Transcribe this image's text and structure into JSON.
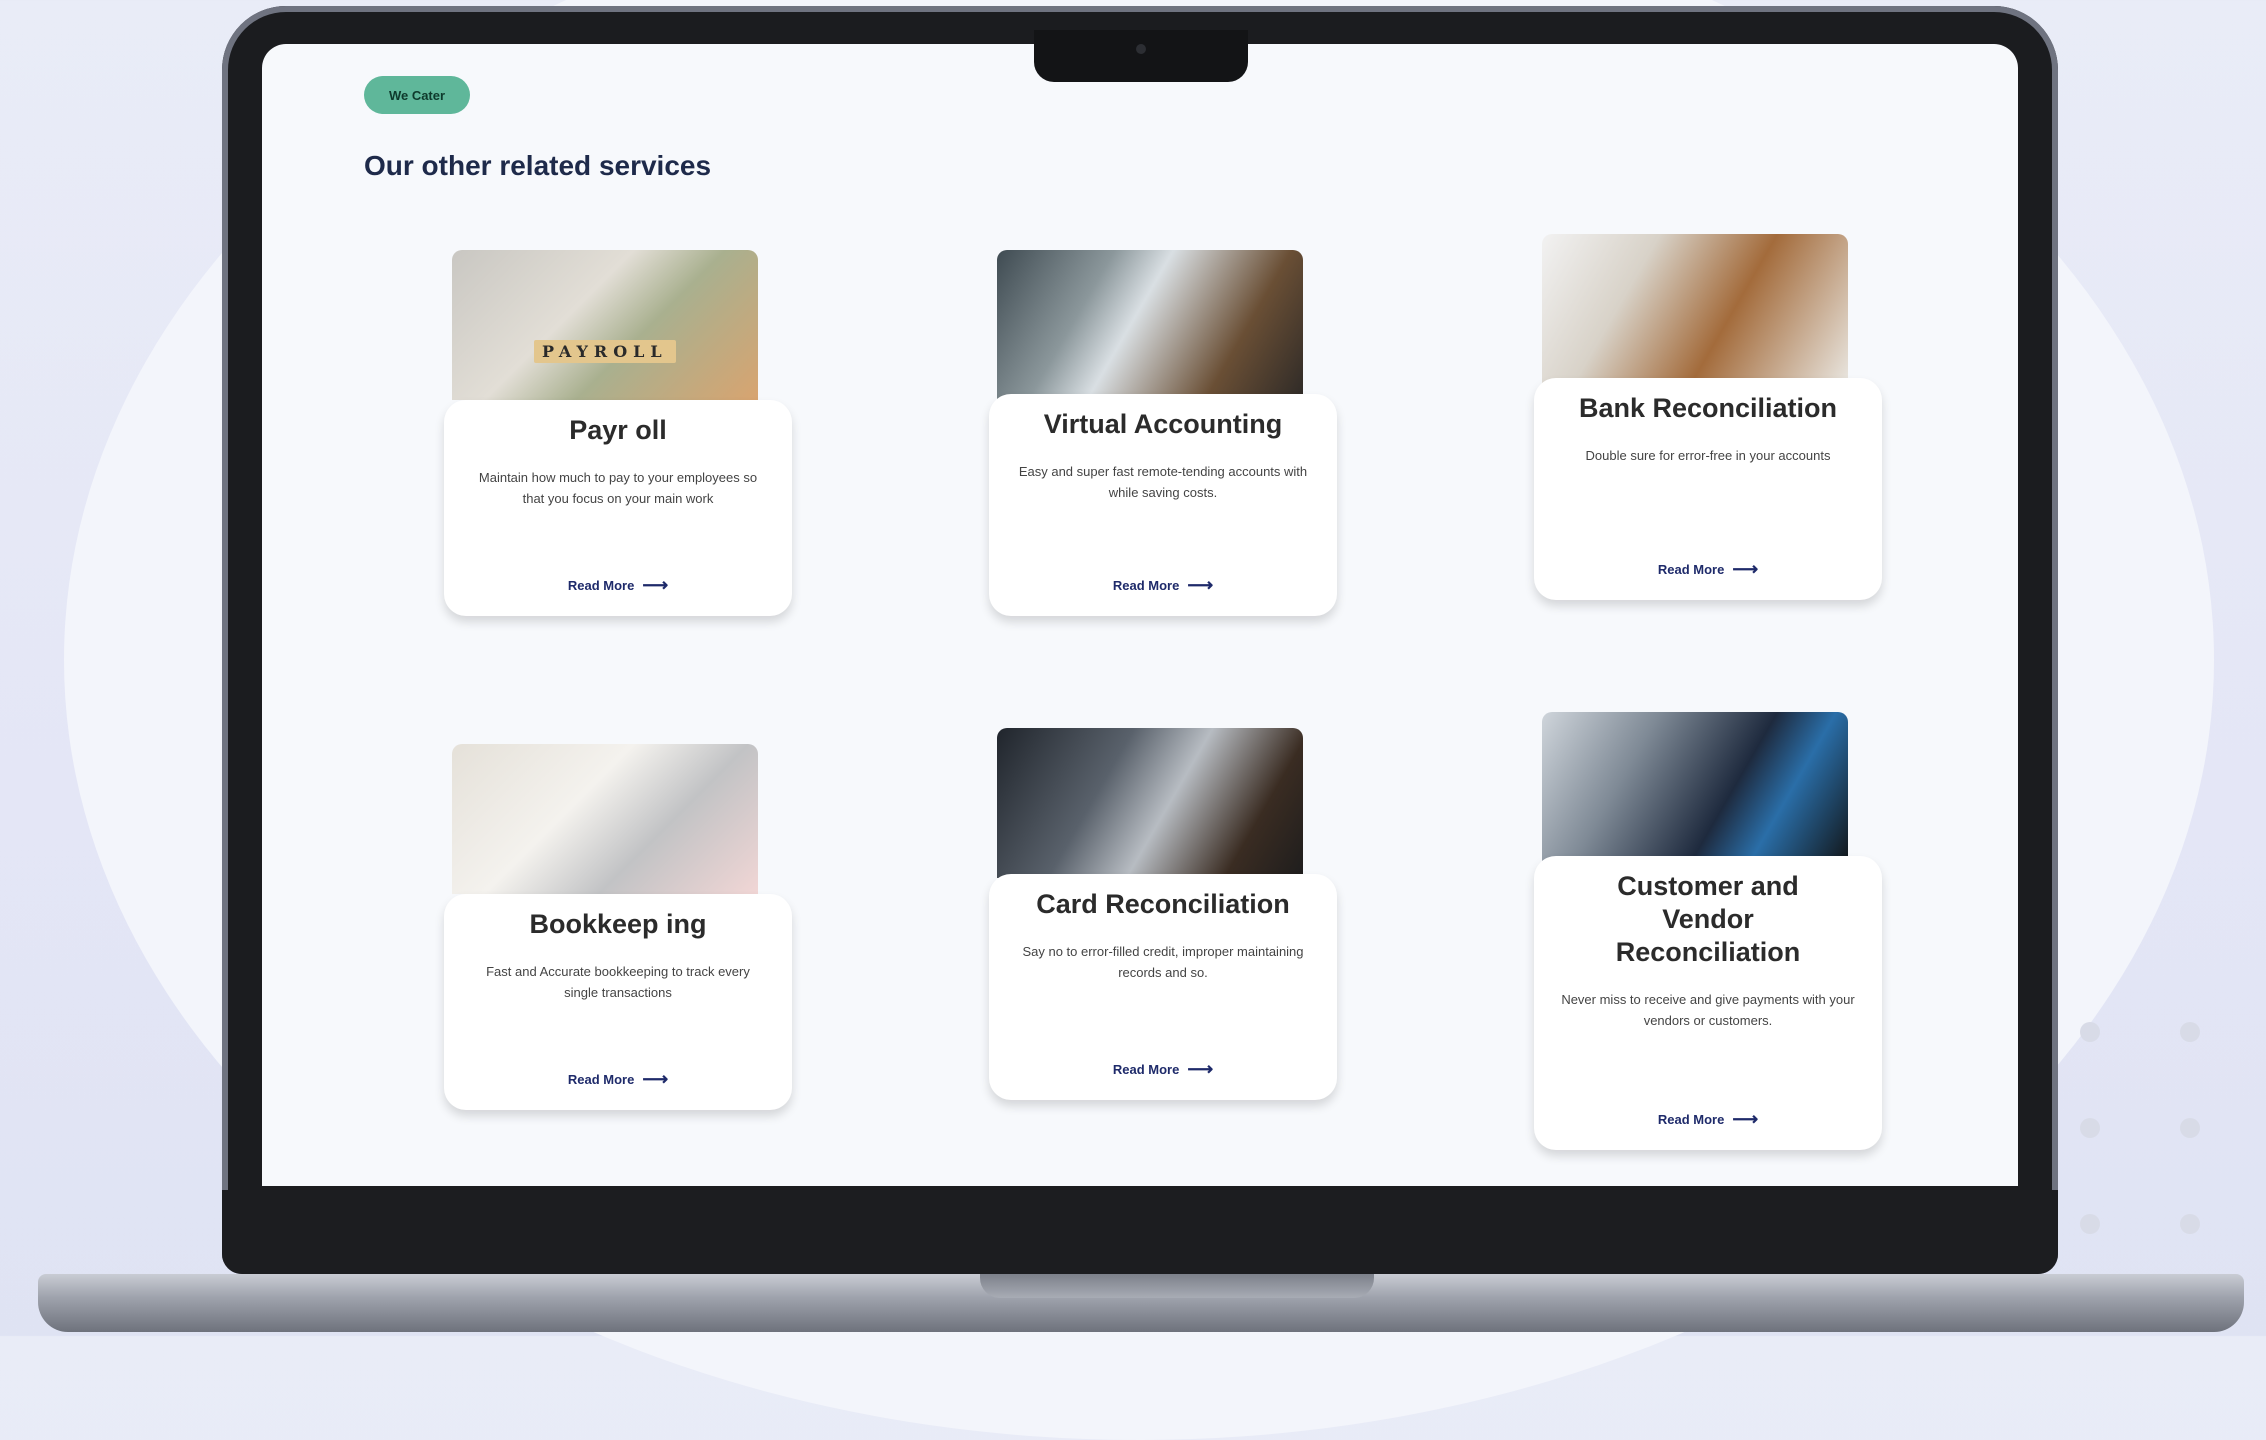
{
  "badge": {
    "label": "We Cater"
  },
  "section": {
    "title": "Our other related services"
  },
  "services": [
    {
      "title": "Payr oll",
      "description": "Maintain how much to pay to your employees so that you focus on your main work",
      "link": "Read More",
      "image_icon": "payroll-image"
    },
    {
      "title": "Virtual Accounting",
      "description": "Easy and super fast remote-tending accounts with while saving costs.",
      "link": "Read More",
      "image_icon": "virtual-accounting-image"
    },
    {
      "title": "Bank Reconciliation",
      "description": "Double sure for error-free in your accounts",
      "link": "Read More",
      "image_icon": "bank-reconciliation-image"
    },
    {
      "title": "Bookkeep ing",
      "description": "Fast and Accurate bookkeeping to track every single transactions",
      "link": "Read More",
      "image_icon": "bookkeeping-image"
    },
    {
      "title": "Card Reconciliation",
      "description": "Say no to error-filled credit, improper maintaining records and so.",
      "link": "Read More",
      "image_icon": "card-reconciliation-image"
    },
    {
      "title": "Customer and Vendor Reconciliation",
      "description": "Never miss to receive and give payments with your vendors or customers.",
      "link": "Read More",
      "image_icon": "customer-vendor-image"
    }
  ],
  "image_text": {
    "payroll_tiles": "PAYROLL"
  },
  "colors": {
    "badge_bg": "#5fb79a",
    "title": "#1e2a4a",
    "link": "#1e2a6a",
    "laptop": "#1b1c1f"
  }
}
